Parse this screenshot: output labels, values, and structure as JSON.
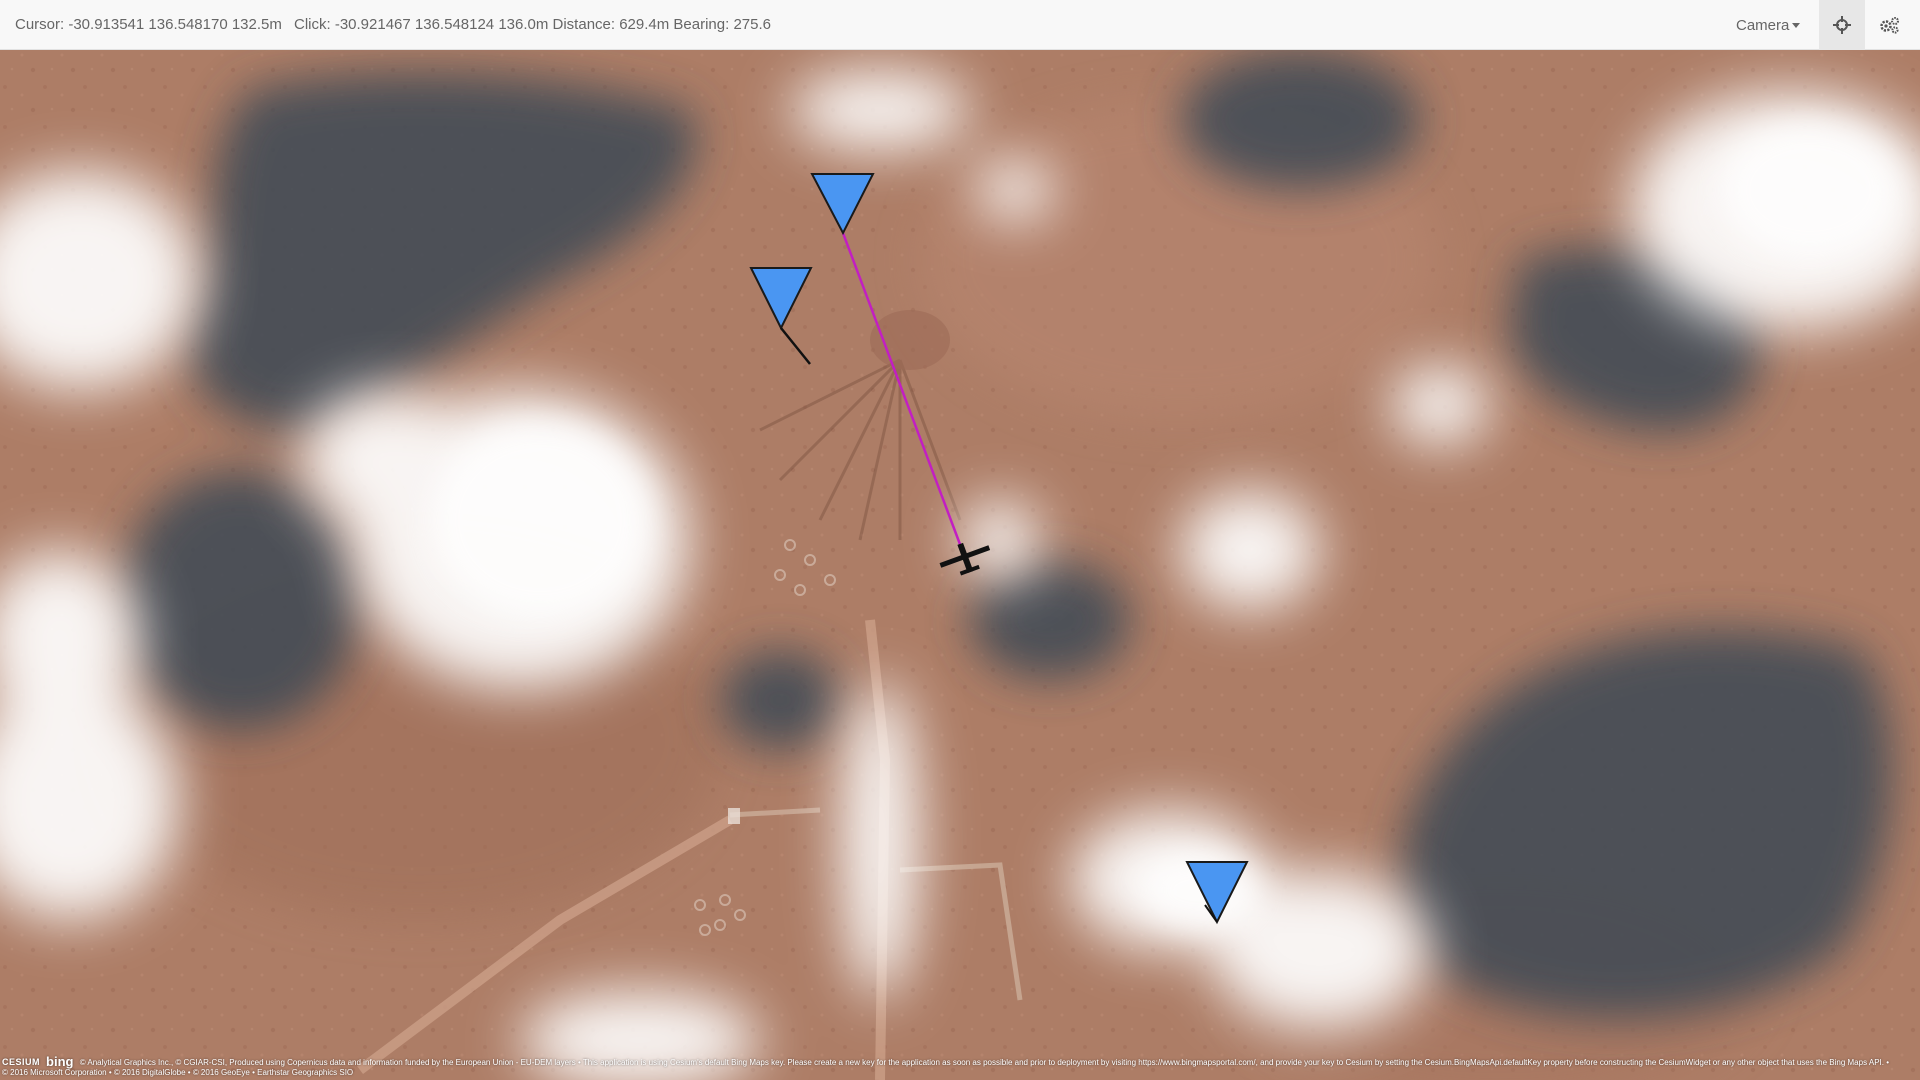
{
  "topbar": {
    "cursor_readout": "Cursor: -30.913541 136.548170 132.5m",
    "click_readout": "Click: -30.921467 136.548124 136.0m Distance: 629.4m Bearing: 275.6",
    "camera_label": "Camera",
    "target_icon": "crosshair-icon",
    "settings_icon": "gears-icon"
  },
  "map": {
    "waypoint_color": "#4a96f2",
    "route_line_color": "#c21fc2",
    "aircraft_icon": "aircraft-icon"
  },
  "credits": {
    "cesium_logo": "CESIUM",
    "bing_logo": "bing",
    "line1": "© Analytical Graphics Inc., © CGIAR-CSI, Produced using Copernicus data and information funded by the European Union - EU-DEM layers • This application is using Cesium's default Bing Maps key. Please create a new key for the application as soon as possible and prior to deployment by visiting https://www.bingmapsportal.com/, and provide your key to Cesium by setting the Cesium.BingMapsApi.defaultKey property before constructing the CesiumWidget or any other object that uses the Bing Maps API. •",
    "line2": "© 2016 Microsoft Corporation • © 2016 DigitalGlobe • © 2016 GeoEye • Earthstar Geographics SIO"
  }
}
